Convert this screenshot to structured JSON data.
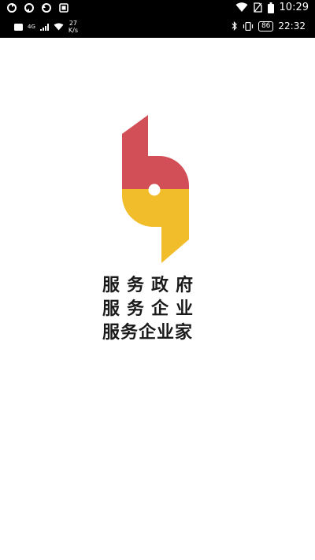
{
  "status_bar": {
    "time": "10:29",
    "secondary_time": "22:32",
    "network_type": "4G",
    "net_speed_value": "27",
    "net_speed_unit": "K/s",
    "battery_level": "86"
  },
  "splash": {
    "slogan": [
      "服务政府",
      "服务企业",
      "服务企业家"
    ],
    "colors": {
      "red": "#d24f57",
      "yellow": "#f2bd2a",
      "text": "#1a1a1a"
    }
  }
}
